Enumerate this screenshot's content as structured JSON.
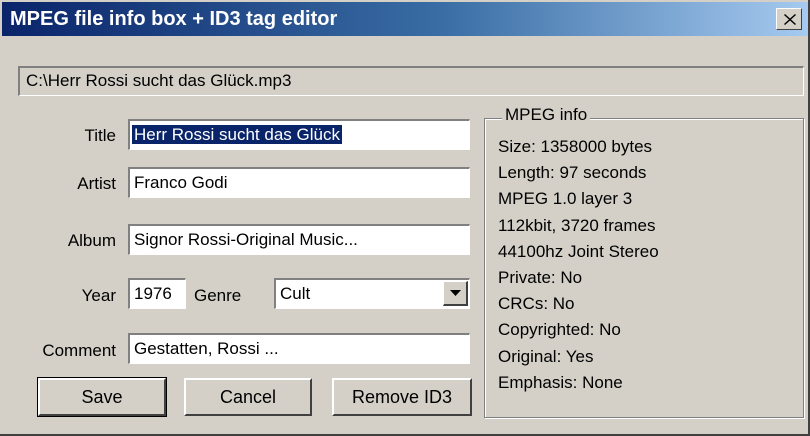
{
  "window": {
    "title": "MPEG file info box + ID3 tag editor",
    "close_icon": "close-icon"
  },
  "file_path": "C:\\Herr Rossi sucht das Glück.mp3",
  "tags": {
    "title_label": "Title",
    "title_value": "Herr Rossi sucht das Glück",
    "artist_label": "Artist",
    "artist_value": "Franco Godi",
    "album_label": "Album",
    "album_value": "Signor Rossi-Original Music...",
    "year_label": "Year",
    "year_value": "1976",
    "genre_label": "Genre",
    "genre_value": "Cult",
    "comment_label": "Comment",
    "comment_value": "Gestatten, Rossi ..."
  },
  "buttons": {
    "save": "Save",
    "cancel": "Cancel",
    "remove_id3": "Remove ID3"
  },
  "mpeg_info": {
    "heading": "MPEG info",
    "lines": [
      "Size: 1358000 bytes",
      "Length: 97 seconds",
      "MPEG 1.0 layer 3",
      "112kbit, 3720 frames",
      "44100hz Joint Stereo",
      "Private: No",
      "CRCs: No",
      "Copyrighted: No",
      "Original: Yes",
      "Emphasis: None"
    ]
  },
  "colors": {
    "face": "#d4d0c8",
    "title_gradient_start": "#0a246a",
    "title_gradient_end": "#a6caf0",
    "selection": "#0a246a"
  }
}
